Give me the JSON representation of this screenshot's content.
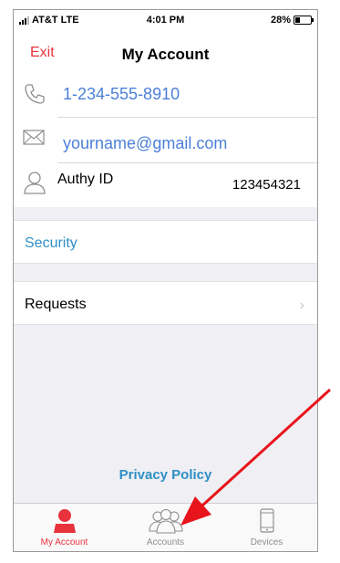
{
  "status_bar": {
    "carrier": "AT&T LTE",
    "time": "4:01 PM",
    "battery": "28%"
  },
  "nav": {
    "exit_label": "Exit",
    "title": "My Account"
  },
  "account": {
    "phone": "1-234-555-8910",
    "email": "yourname@gmail.com",
    "authy_id_label": "Authy ID",
    "authy_id_value": "123454321"
  },
  "menu": {
    "security_label": "Security",
    "requests_label": "Requests"
  },
  "footer": {
    "privacy_policy": "Privacy Policy"
  },
  "tab_bar": {
    "tabs": [
      {
        "label": "My Account",
        "icon": "person-icon",
        "active": true
      },
      {
        "label": "Accounts",
        "icon": "people-group-icon",
        "active": false
      },
      {
        "label": "Devices",
        "icon": "phone-device-icon",
        "active": false
      }
    ]
  },
  "colors": {
    "accent_red": "#e8323c",
    "link_blue": "#4c7fd9",
    "security_blue": "#2e8fc4",
    "arrow_red": "#e8141b"
  }
}
